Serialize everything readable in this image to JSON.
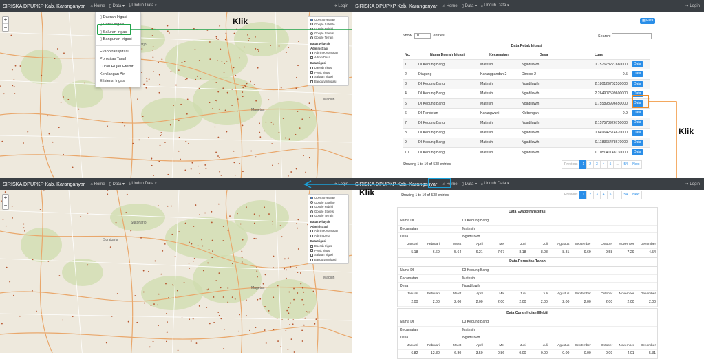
{
  "app": {
    "brand": "SIRISKA DPUPKP Kab. Karanganyar",
    "nav_home": "Home",
    "nav_data": "Data",
    "nav_unduh": "Unduh Data",
    "nav_login": "Login"
  },
  "map": {
    "zoom_in": "+",
    "zoom_out": "−",
    "base_layers": [
      "OpenStreetMap",
      "Google Satellite",
      "Google Hybrid",
      "Google Streets",
      "Google Terrain"
    ],
    "admin_title": "Batas Wilayah Administrasi",
    "admin_layers": [
      "Admin Kecamatan",
      "Admin Desa"
    ],
    "irigasi_title": "Data Irigasi",
    "irigasi_layers": [
      "Daerah Irigasi",
      "Petak Irigasi",
      "Saluran Irigasi",
      "Bangunan Irigasi"
    ],
    "labels": {
      "sukoharjo": "Sukoharjo",
      "magetan": "Magetan",
      "madiun": "Madiun",
      "surakarta": "Surakarta"
    }
  },
  "dropdown": {
    "group1": [
      "Daerah Irigasi",
      "Petak Irigasi",
      "Saluran Irigasi",
      "Bangunan Irigasi"
    ],
    "group2": [
      "Evapotranspirasi",
      "Porositas Tanah",
      "Curah Hujan Efektif",
      "Kehilangan Air",
      "Efisiensi Irigasi"
    ]
  },
  "annotations": {
    "klik_top": "Klik",
    "klik_right": "Klik",
    "klik_bottom": "Klik"
  },
  "petak": {
    "peta_button": "Peta",
    "show_label": "Show",
    "show_value": "10",
    "entries_label": "entries",
    "search_label": "Search:",
    "table_title": "Data Petak Irigasi",
    "columns": [
      "No.",
      "Nama Daerah Irigasi",
      "Kecamatan",
      "Desa",
      "Luas",
      ""
    ],
    "rows": [
      [
        "1.",
        "DI Kedung Bang",
        "Matesih",
        "Ngadiluwih",
        "0.757678227660000"
      ],
      [
        "2.",
        "Diagung",
        "Karangpandan 2",
        "Dimoro 2",
        "0.5"
      ],
      [
        "3.",
        "DI Kedung Bang",
        "Matesih",
        "Ngadiluwih",
        "2.180129762530000"
      ],
      [
        "4.",
        "DI Kedung Bang",
        "Matesih",
        "Ngadiluwih",
        "2.264907599600000"
      ],
      [
        "5.",
        "DI Kedung Bang",
        "Matesih",
        "Ngadiluwih",
        "1.755898996650000"
      ],
      [
        "6.",
        "DI Pendelan",
        "Karangwuni",
        "Klebengan",
        "0.9"
      ],
      [
        "7.",
        "DI Kedung Bang",
        "Matesih",
        "Ngadiluwih",
        "2.157578926750000"
      ],
      [
        "8.",
        "DI Kedung Bang",
        "Matesih",
        "Ngadiluwih",
        "0.849642574620000"
      ],
      [
        "9.",
        "DI Kedung Bang",
        "Matesih",
        "Ngadiluwih",
        "0.118365478670000"
      ],
      [
        "10.",
        "DI Kedung Bang",
        "Matesih",
        "Ngadiluwih",
        "0.105041148130000"
      ]
    ],
    "data_button": "Data",
    "info": "Showing 1 to 10 of 538 entries",
    "pages": [
      "Previous",
      "1",
      "2",
      "3",
      "4",
      "5",
      "...",
      "54",
      "Next"
    ]
  },
  "detail": {
    "info": "Showing 1 to 10 of 538 entries",
    "months": [
      "Januari",
      "Februari",
      "Maret",
      "April",
      "Mei",
      "Juni",
      "Juli",
      "Agustus",
      "September",
      "Oktober",
      "November",
      "Desember"
    ],
    "field_labels": [
      "Nama DI",
      "Kecamatan",
      "Desa"
    ],
    "field_values": [
      "DI Kedung Bang",
      "Matesih",
      "Ngadiluwih"
    ],
    "tables": [
      {
        "title": "Data Evapotranspirasi",
        "values": [
          "5.18",
          "6.69",
          "5.64",
          "6.21",
          "7.67",
          "8.18",
          "8.08",
          "8.81",
          "9.69",
          "9.58",
          "7.29",
          "4.54"
        ]
      },
      {
        "title": "Data Porositas Tanah",
        "values": [
          "2.00",
          "2.00",
          "2.00",
          "2.00",
          "2.00",
          "2.00",
          "2.00",
          "2.00",
          "2.00",
          "2.00",
          "2.00",
          "2.00"
        ]
      },
      {
        "title": "Data Curah Hujan Efektif",
        "values": [
          "6.82",
          "12.30",
          "6.80",
          "3.50",
          "0.86",
          "0.00",
          "0.00",
          "0.00",
          "0.00",
          "0.09",
          "4.01",
          "5.31"
        ]
      }
    ]
  },
  "colors": {
    "green": "#21a34a",
    "orange": "#ef8c2a",
    "blue": "#1aa0d8",
    "navbar": "#3a3f44",
    "primary": "#2a8ee8"
  }
}
